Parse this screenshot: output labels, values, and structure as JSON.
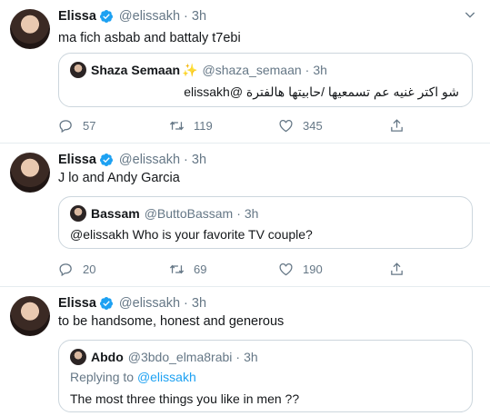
{
  "colors": {
    "verified": "#1da1f2",
    "muted": "#657786",
    "border": "#e6ecf0"
  },
  "tweets": [
    {
      "name": "Elissa",
      "handle": "@elissakh",
      "sep": "·",
      "time": "3h",
      "text": "ma fich asbab and battaly t7ebi",
      "quote": {
        "name": "Shaza Semaan",
        "name_emoji": "✨",
        "handle": "@shaza_semaan",
        "sep": "·",
        "time": "3h",
        "text": "شو اكتر غنيه عم تسمعيها /حابيتها هالفترة @elissakh"
      },
      "replies": "57",
      "retweets": "119",
      "likes": "345"
    },
    {
      "name": "Elissa",
      "handle": "@elissakh",
      "sep": "·",
      "time": "3h",
      "text": "J lo and Andy Garcia",
      "quote": {
        "name": "Bassam",
        "handle": "@ButtoBassam",
        "sep": "·",
        "time": "3h",
        "text": "@elissakh Who is your favorite TV couple?"
      },
      "replies": "20",
      "retweets": "69",
      "likes": "190"
    },
    {
      "name": "Elissa",
      "handle": "@elissakh",
      "sep": "·",
      "time": "3h",
      "text": "to be handsome, honest and generous",
      "quote": {
        "name": "Abdo",
        "handle": "@3bdo_elma8rabi",
        "sep": "·",
        "time": "3h",
        "replying_prefix": "Replying to",
        "replying_handle": "@elissakh",
        "text": "The most three things you like in men ??"
      }
    }
  ],
  "icons": [
    "verified-badge-icon",
    "chevron-down-icon",
    "reply-icon",
    "retweet-icon",
    "like-icon",
    "share-icon"
  ]
}
